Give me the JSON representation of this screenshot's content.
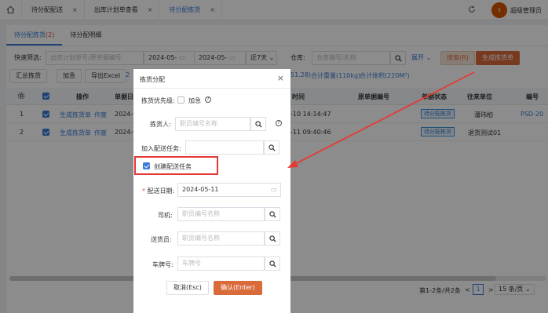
{
  "tabs": [
    {
      "label": "待分配配送"
    },
    {
      "label": "出库计划单查看"
    },
    {
      "label": "待分配拣货"
    }
  ],
  "user": {
    "avatar_text": "ll",
    "name": "超级管理员"
  },
  "subtabs": [
    {
      "label": "待分配拣货",
      "count": "(2)"
    },
    {
      "label": "待分配明细"
    }
  ],
  "filter": {
    "quick_label": "快速筛选:",
    "quick_placeholder": "出库计划单号/原单据编号",
    "date_from": "2024-05-",
    "date_to": "2024-05-",
    "date_range": "近7天",
    "warehouse_label": "仓库:",
    "warehouse_placeholder": "仓库编号/名称",
    "expand_label": "展开",
    "search_label": "搜索(R)",
    "generate_label": "生成拣货单"
  },
  "toolbar": {
    "summary_label": "汇总拣货",
    "urgent_label": "加急",
    "export_label": "导出Excel",
    "sum_head": "2",
    "sum_tail": "51.28)",
    "weight": "合计重量(110kg)",
    "volume": "合计体积(220M³)"
  },
  "table": {
    "headers": [
      "操作",
      "单据日",
      "时间",
      "原单据编号",
      "单据状态",
      "往来单位",
      "编号"
    ],
    "rows": [
      {
        "no": "1",
        "op1": "生成拣货单",
        "op2": "作废",
        "date": "2024-0",
        "time": "-10 14:14:47",
        "status": "待分配拣货",
        "partner": "潘玮柏",
        "code": "PSD-20"
      },
      {
        "no": "2",
        "op1": "生成拣货单",
        "op2": "作废",
        "date": "2024-0",
        "time": "-11 09:40:46",
        "status": "待分配拣货",
        "partner": "退货测试01",
        "code": ""
      }
    ]
  },
  "pager": {
    "info": "第1-2条/共2条",
    "prev": "<",
    "page": "1",
    "next": ">",
    "size": "15 条/页"
  },
  "modal": {
    "title": "拣货分配",
    "priority_label": "拣货优先级:",
    "urgent_label": "加急",
    "picker_label": "拣货人:",
    "picker_placeholder": "职员编号名称",
    "delivery_task_label": "加入配送任务:",
    "create_task_label": "创建配送任务",
    "delivery_date_label": "配送日期:",
    "delivery_date": "2024-05-11",
    "driver_label": "司机:",
    "driver_placeholder": "职员编号名称",
    "deliverer_label": "送货员:",
    "deliverer_placeholder": "职员编号名称",
    "plate_label": "车牌号:",
    "plate_placeholder": "车牌号",
    "cancel_label": "取消(Esc)",
    "confirm_label": "确认(Enter)"
  },
  "colors": {
    "accent": "#3a7bd5",
    "primary_orange": "#d96a3a",
    "annotation_red": "#e53935"
  }
}
